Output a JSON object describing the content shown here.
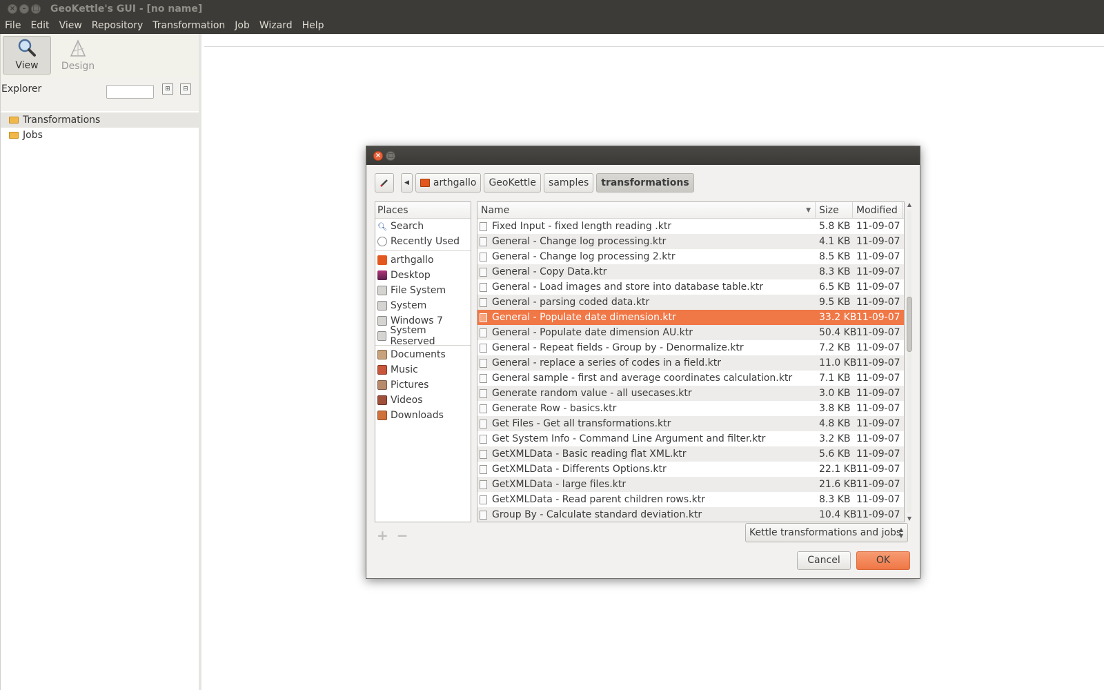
{
  "window": {
    "title": "GeoKettle's GUI - [no name]"
  },
  "menubar": {
    "items": [
      "File",
      "Edit",
      "View",
      "Repository",
      "Transformation",
      "Job",
      "Wizard",
      "Help"
    ]
  },
  "left_panel": {
    "perspectives": {
      "view": "View",
      "design": "Design"
    },
    "explorer_label": "Explorer",
    "tree": [
      "Transformations",
      "Jobs"
    ]
  },
  "dialog": {
    "path": [
      "arthgallo",
      "GeoKettle",
      "samples",
      "transformations"
    ],
    "places_header": "Places",
    "places_group1": [
      "Search",
      "Recently Used"
    ],
    "places_group2": [
      "arthgallo",
      "Desktop",
      "File System",
      "System",
      "Windows 7",
      "System Reserved"
    ],
    "places_group3": [
      "Documents",
      "Music",
      "Pictures",
      "Videos",
      "Downloads"
    ],
    "columns": {
      "name": "Name",
      "size": "Size",
      "modified": "Modified"
    },
    "files": [
      {
        "name": "Fixed Input - fixed length reading .ktr",
        "size": "5.8 KB",
        "modified": "11-09-07"
      },
      {
        "name": "General - Change log processing.ktr",
        "size": "4.1 KB",
        "modified": "11-09-07"
      },
      {
        "name": "General - Change log processing 2.ktr",
        "size": "8.5 KB",
        "modified": "11-09-07"
      },
      {
        "name": "General - Copy Data.ktr",
        "size": "8.3 KB",
        "modified": "11-09-07"
      },
      {
        "name": "General - Load images and store into database table.ktr",
        "size": "6.5 KB",
        "modified": "11-09-07"
      },
      {
        "name": "General - parsing coded data.ktr",
        "size": "9.5 KB",
        "modified": "11-09-07"
      },
      {
        "name": "General - Populate date dimension.ktr",
        "size": "33.2 KB",
        "modified": "11-09-07",
        "selected": true
      },
      {
        "name": "General - Populate date dimension AU.ktr",
        "size": "50.4 KB",
        "modified": "11-09-07"
      },
      {
        "name": "General - Repeat fields - Group by - Denormalize.ktr",
        "size": "7.2 KB",
        "modified": "11-09-07"
      },
      {
        "name": "General - replace a series of codes in a field.ktr",
        "size": "11.0 KB",
        "modified": "11-09-07"
      },
      {
        "name": "General sample - first and average coordinates calculation.ktr",
        "size": "7.1 KB",
        "modified": "11-09-07"
      },
      {
        "name": "Generate random value - all usecases.ktr",
        "size": "3.0 KB",
        "modified": "11-09-07"
      },
      {
        "name": "Generate Row - basics.ktr",
        "size": "3.8 KB",
        "modified": "11-09-07"
      },
      {
        "name": "Get Files - Get all transformations.ktr",
        "size": "4.8 KB",
        "modified": "11-09-07"
      },
      {
        "name": "Get System Info - Command Line Argument and filter.ktr",
        "size": "3.2 KB",
        "modified": "11-09-07"
      },
      {
        "name": "GetXMLData - Basic reading flat XML.ktr",
        "size": "5.6 KB",
        "modified": "11-09-07"
      },
      {
        "name": "GetXMLData - Differents Options.ktr",
        "size": "22.1 KB",
        "modified": "11-09-07"
      },
      {
        "name": "GetXMLData - large files.ktr",
        "size": "21.6 KB",
        "modified": "11-09-07"
      },
      {
        "name": "GetXMLData - Read parent children rows.ktr",
        "size": "8.3 KB",
        "modified": "11-09-07"
      },
      {
        "name": "Group By - Calculate standard deviation.ktr",
        "size": "10.4 KB",
        "modified": "11-09-07"
      }
    ],
    "filter": "Kettle transformations and jobs",
    "cancel_label": "Cancel",
    "ok_label": "OK"
  },
  "colors": {
    "accent": "#f07746",
    "titlebar": "#3c3b37"
  }
}
